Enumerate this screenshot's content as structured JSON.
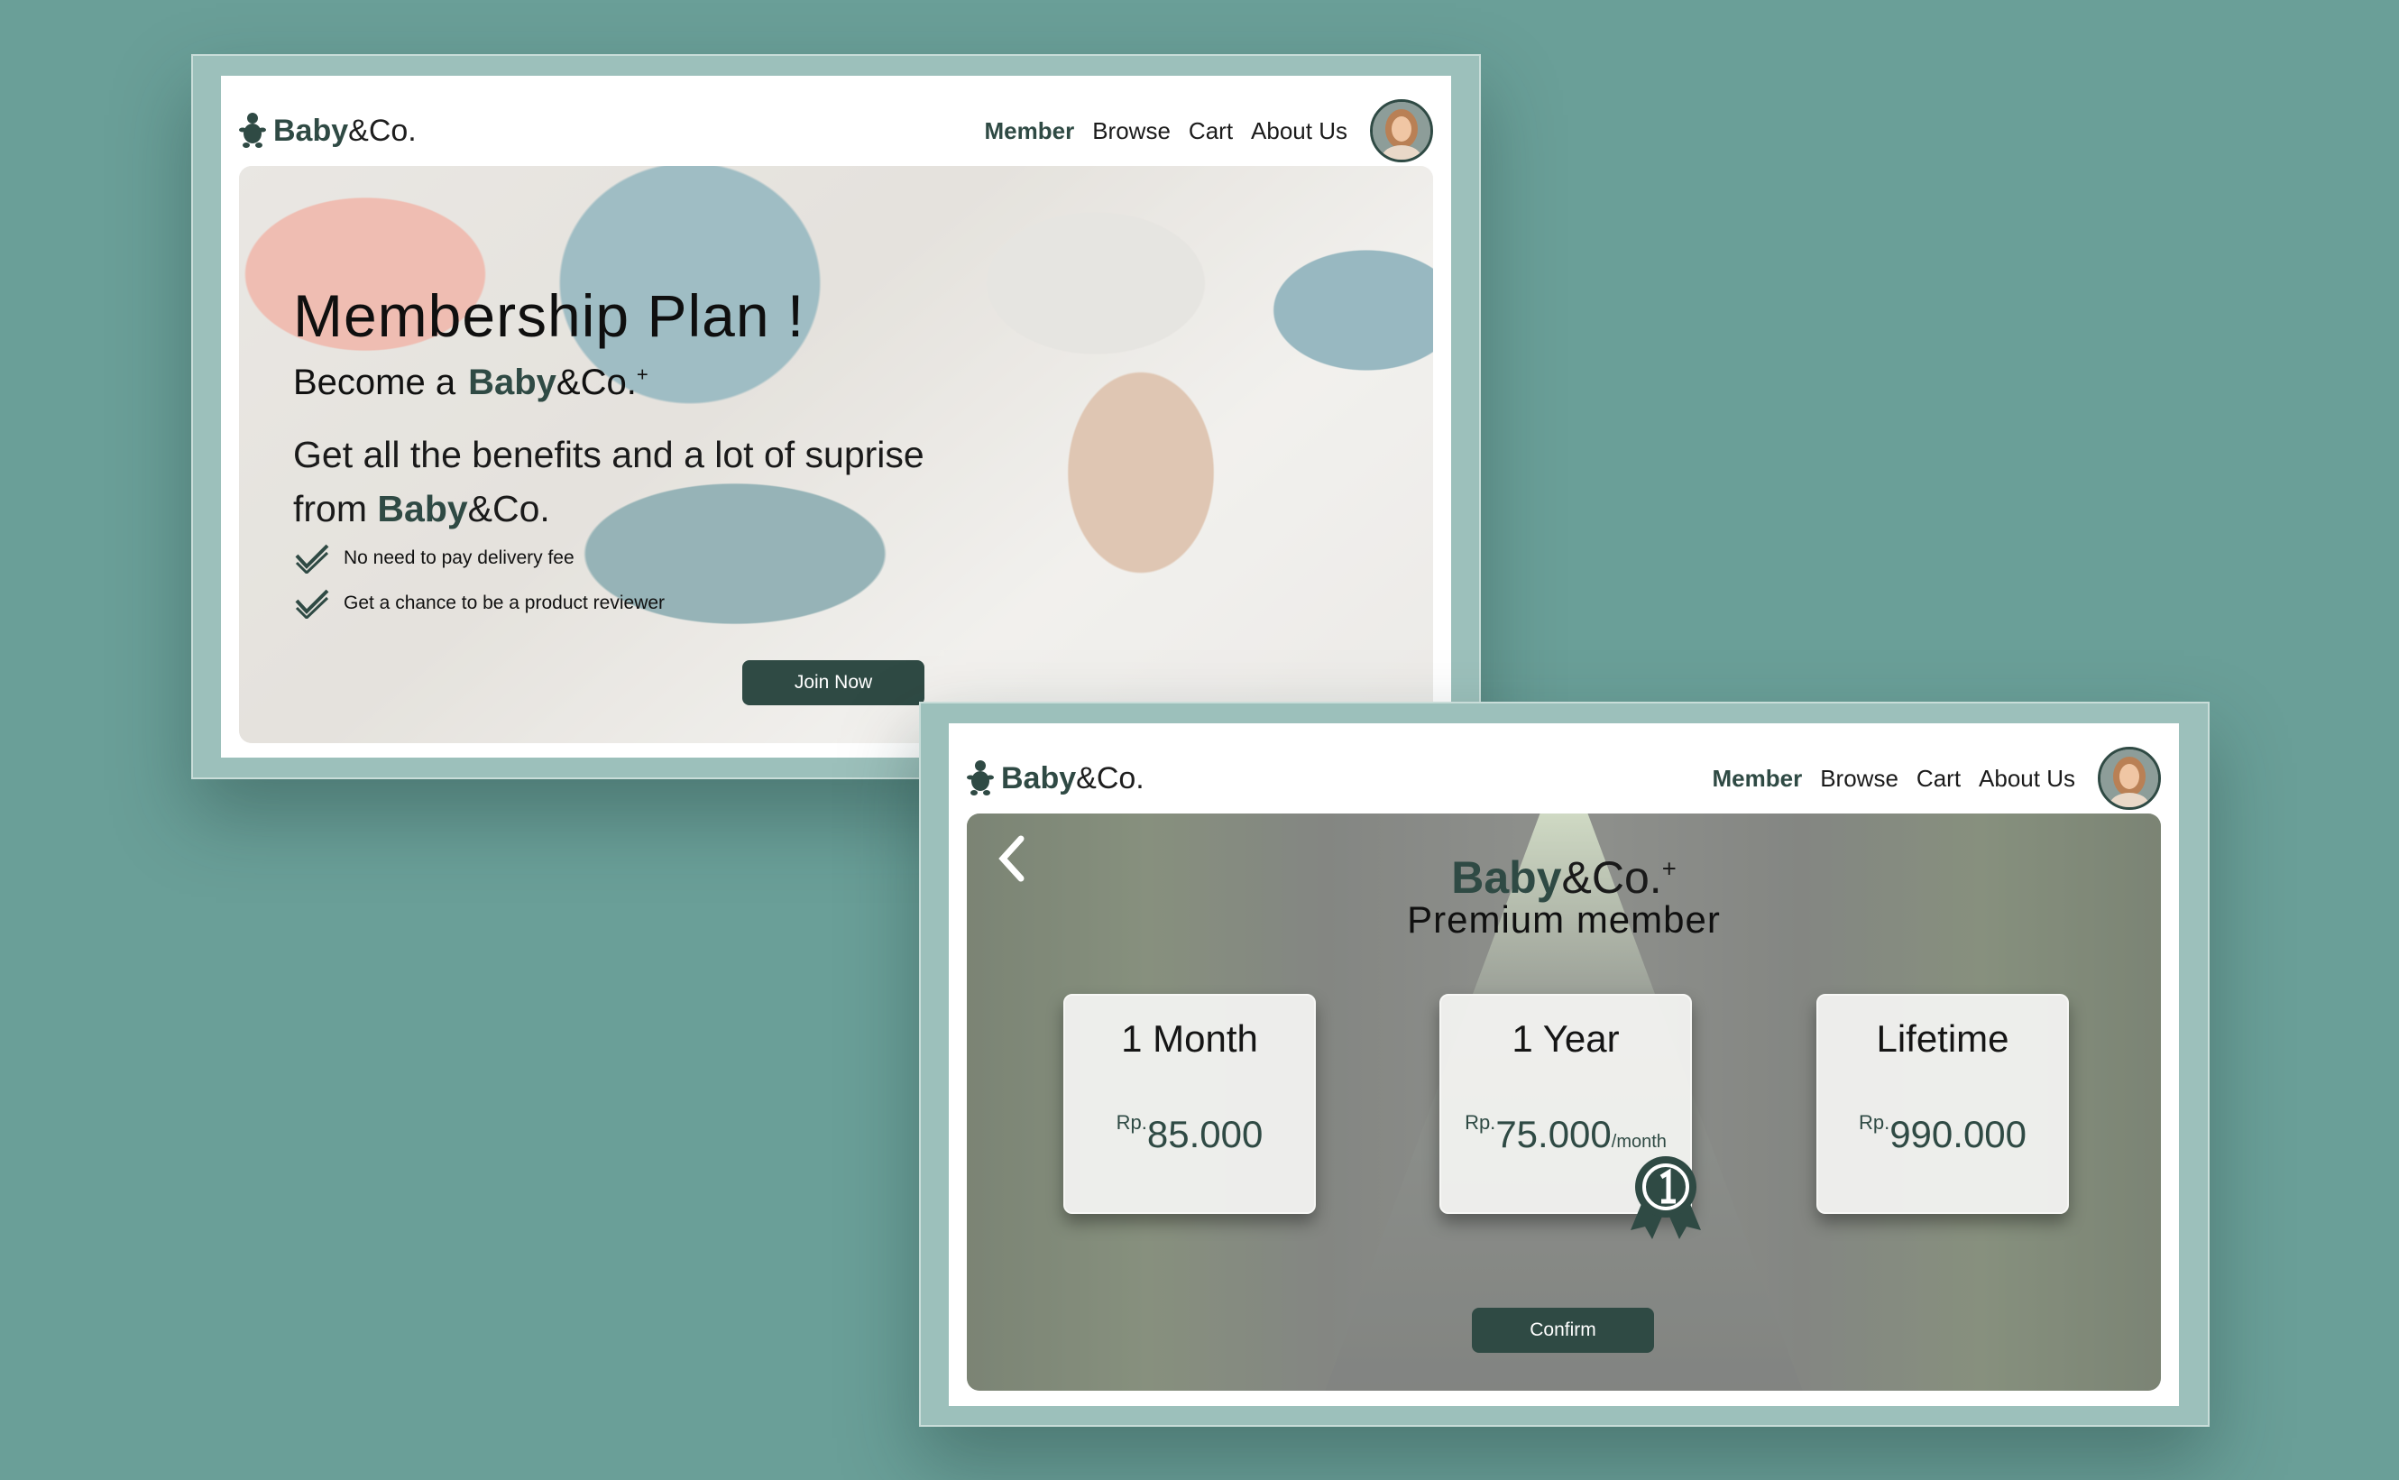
{
  "colors": {
    "background": "#6a9f98",
    "brand": "#2f4a44",
    "frame": "#9cc0bb"
  },
  "icons": {
    "logo": "baby-logo-icon",
    "check": "double-check-icon",
    "back": "chevron-left-icon",
    "award": "award-ribbon-icon",
    "avatar": "user-avatar"
  },
  "screen1": {
    "logo": {
      "bold": "Baby",
      "rest": "&Co."
    },
    "nav": {
      "member": "Member",
      "browse": "Browse",
      "cart": "Cart",
      "about": "About Us"
    },
    "hero": {
      "title": "Membership Plan !",
      "subtitle_prefix": "Become a",
      "brand_bold": "Baby",
      "brand_rest": "&Co.",
      "brand_plus": "+",
      "description_line1": "Get all the benefits and a lot of suprise",
      "description_from": "from",
      "description_brand_bold": "Baby",
      "description_brand_rest": "&Co.",
      "benefits": [
        "No need to pay delivery fee",
        "Get a chance to be a product reviewer"
      ],
      "join_label": "Join Now"
    }
  },
  "screen2": {
    "logo": {
      "bold": "Baby",
      "rest": "&Co."
    },
    "nav": {
      "member": "Member",
      "browse": "Browse",
      "cart": "Cart",
      "about": "About Us"
    },
    "hero": {
      "brand_bold": "Baby",
      "brand_rest": "&Co.",
      "brand_plus": "+",
      "premium": "Premium member",
      "plans": [
        {
          "name": "1 Month",
          "currency": "Rp.",
          "price": "85.000",
          "per": ""
        },
        {
          "name": "1 Year",
          "currency": "Rp.",
          "price": "75.000",
          "per": "/month"
        },
        {
          "name": "Lifetime",
          "currency": "Rp.",
          "price": "990.000",
          "per": ""
        }
      ],
      "confirm_label": "Confirm"
    }
  }
}
